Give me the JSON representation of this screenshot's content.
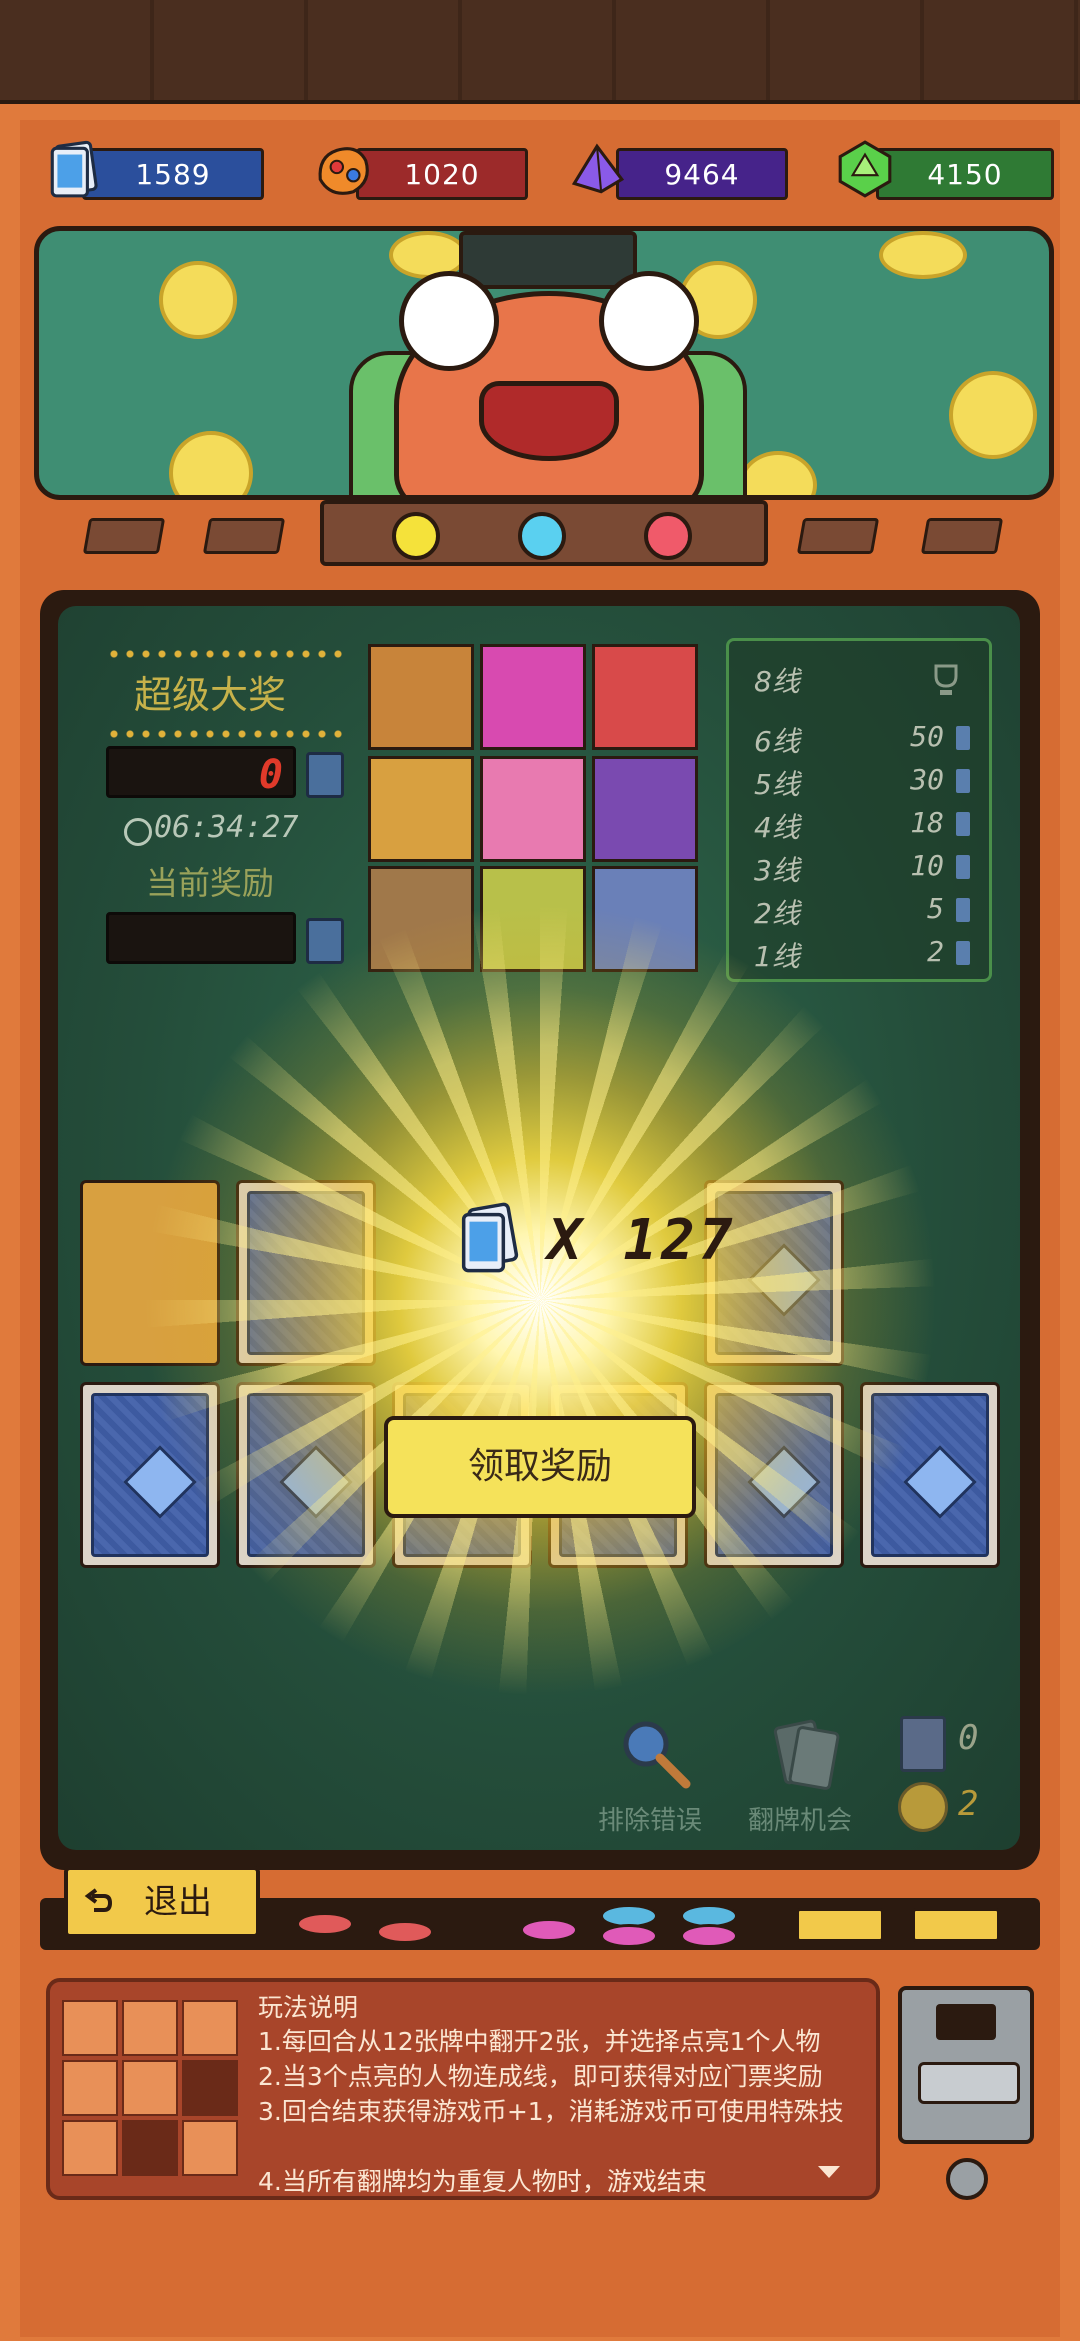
{
  "currency": [
    {
      "name": "tickets",
      "value": "1589",
      "color": "#2b4f9c",
      "icon": "ticket-icon"
    },
    {
      "name": "gem-bag",
      "value": "1020",
      "color": "#9c2a2a",
      "icon": "bag-icon"
    },
    {
      "name": "crystal",
      "value": "9464",
      "color": "#46238a",
      "icon": "crystal-icon"
    },
    {
      "name": "green-gem",
      "value": "4150",
      "color": "#2f7a34",
      "icon": "emerald-icon"
    }
  ],
  "lights": {
    "yellow": "#f5e23a",
    "blue": "#5ad0f0",
    "red": "#f05a6a"
  },
  "jackpot": {
    "title": "超级大奖",
    "super_counter": "0",
    "timer": "06:34:27",
    "current_reward_label": "当前奖励",
    "current_counter": ""
  },
  "paytable": {
    "header_line": "8线",
    "rows": [
      {
        "line": "6线",
        "value": "50"
      },
      {
        "line": "5线",
        "value": "30"
      },
      {
        "line": "4线",
        "value": "18"
      },
      {
        "line": "3线",
        "value": "10"
      },
      {
        "line": "2线",
        "value": "5"
      },
      {
        "line": "1线",
        "value": "2"
      }
    ]
  },
  "reward": {
    "amount_text": "X 127",
    "claim_label": "领取奖励"
  },
  "tools": {
    "eliminate_label": "排除错误",
    "flip_label": "翻牌机会",
    "card_count": "0",
    "coin_count": "2"
  },
  "exit_label": "退出",
  "instructions": {
    "title": "玩法说明",
    "lines": [
      "1.每回合从12张牌中翻开2张，并选择点亮1个人物",
      "2.当3个点亮的人物连成线，即可获得对应门票奖励",
      "3.回合结束获得游戏币+1，消耗游戏币可使用特殊技",
      "4.当所有翻牌均为重复人物时，游戏结束"
    ]
  }
}
